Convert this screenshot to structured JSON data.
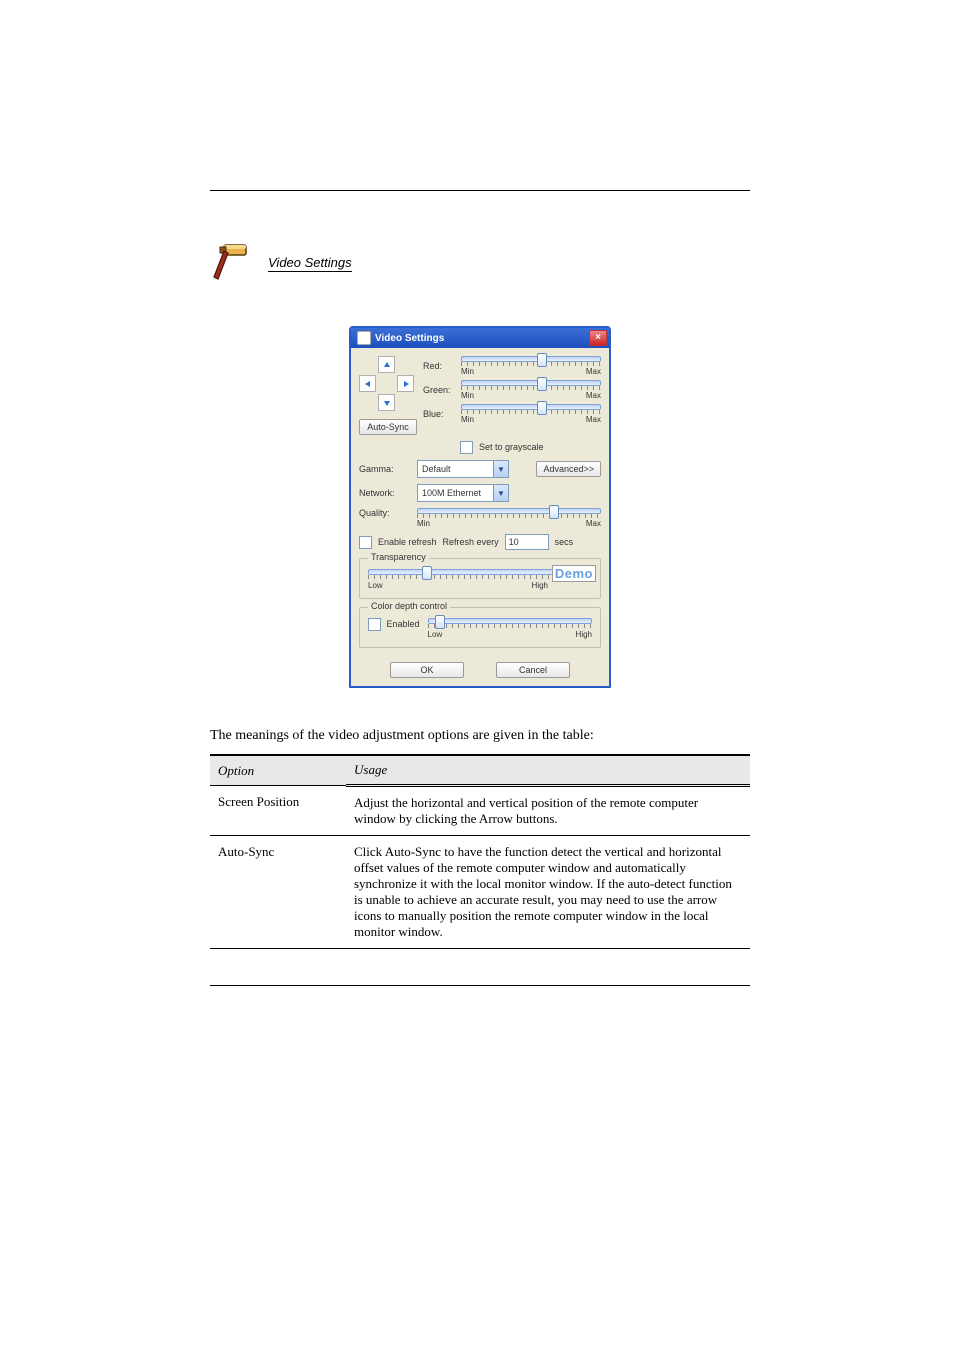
{
  "title_underline": "Video Settings",
  "dialog": {
    "title": "Video Settings",
    "auto_sync": "Auto-Sync",
    "red_label": "Red:",
    "green_label": "Green:",
    "blue_label": "Blue:",
    "min_label": "Min",
    "max_label": "Max",
    "set_grayscale": "Set to grayscale",
    "gamma_label": "Gamma:",
    "gamma_value": "Default",
    "advanced": "Advanced>>",
    "network_label": "Network:",
    "network_value": "100M Ethernet",
    "quality_label": "Quality:",
    "enable_refresh": "Enable refresh",
    "refresh_every": "Refresh every",
    "refresh_value": "10",
    "secs": "secs",
    "transparency_legend": "Transparency",
    "low_label": "Low",
    "high_label": "High",
    "demo_label": "Demo",
    "color_depth_legend": "Color depth control",
    "enabled_label": "Enabled",
    "ok": "OK",
    "cancel": "Cancel"
  },
  "desc": "The meanings of the video adjustment options are given in the table:",
  "table": {
    "h1": "Option",
    "h2": "Usage",
    "rows": [
      {
        "opt": "Screen Position",
        "use": "Adjust the horizontal and vertical position of the remote computer window by clicking the Arrow buttons."
      },
      {
        "opt": "Auto-Sync",
        "use": "Click Auto-Sync to have the function detect the vertical and horizontal offset values of the remote computer window and automatically synchronize it with the local monitor window. If the auto-detect function is unable to achieve an accurate result, you may need to use the arrow icons to manually position the remote computer window in the local monitor window."
      }
    ]
  }
}
